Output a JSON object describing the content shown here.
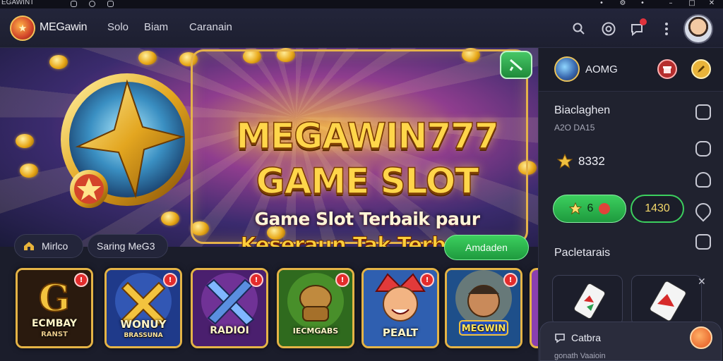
{
  "titlebar": {
    "app_name": "EGAWINT"
  },
  "navbar": {
    "brand": "MEGawin",
    "links": [
      "Solo",
      "Biam",
      "Caranain"
    ]
  },
  "hero": {
    "title_line1": "MEGAWIN777",
    "title_line2": "GAME SLOT",
    "subtitle_line1": "Game Slot Terbaik paur",
    "subtitle_line2": "Keseraun Tak Terbatiis"
  },
  "categories": {
    "chip1": "Mirlco",
    "chip2": "Saring MeG3",
    "primary_button": "Amdaden"
  },
  "games": [
    {
      "label": "ECMBAY",
      "sub": "RANST",
      "badge": "!"
    },
    {
      "label": "WONUY",
      "sub": "BRASSUNA",
      "badge": "!"
    },
    {
      "label": "RADIOI",
      "sub": "",
      "badge": "!"
    },
    {
      "label": "IECMGABS",
      "sub": "",
      "badge": "!"
    },
    {
      "label": "PEALT",
      "sub": "",
      "badge": "!"
    },
    {
      "label": "MEGWIN",
      "sub": "",
      "badge": "!"
    }
  ],
  "panel": {
    "title": "AOMG",
    "section1_title": "Biaclaghen",
    "section1_sub": "A2O DA15",
    "points": "8332",
    "pill_green": "6",
    "pill_outline": "1430",
    "section2_title": "Pacletarais",
    "chat_title": "Catbra",
    "chat_sub": "gonath Vaaioin"
  },
  "colors": {
    "accent_green": "#2fb84f",
    "gold": "#e5b446",
    "badge_red": "#e32c2c",
    "background": "#1b1d2b"
  },
  "icons": [
    "search-icon",
    "settings-icon",
    "chat-icon",
    "menu-dots-icon",
    "star-icon",
    "home-icon",
    "gift-icon",
    "heart-icon",
    "bell-icon",
    "ticket-icon"
  ]
}
